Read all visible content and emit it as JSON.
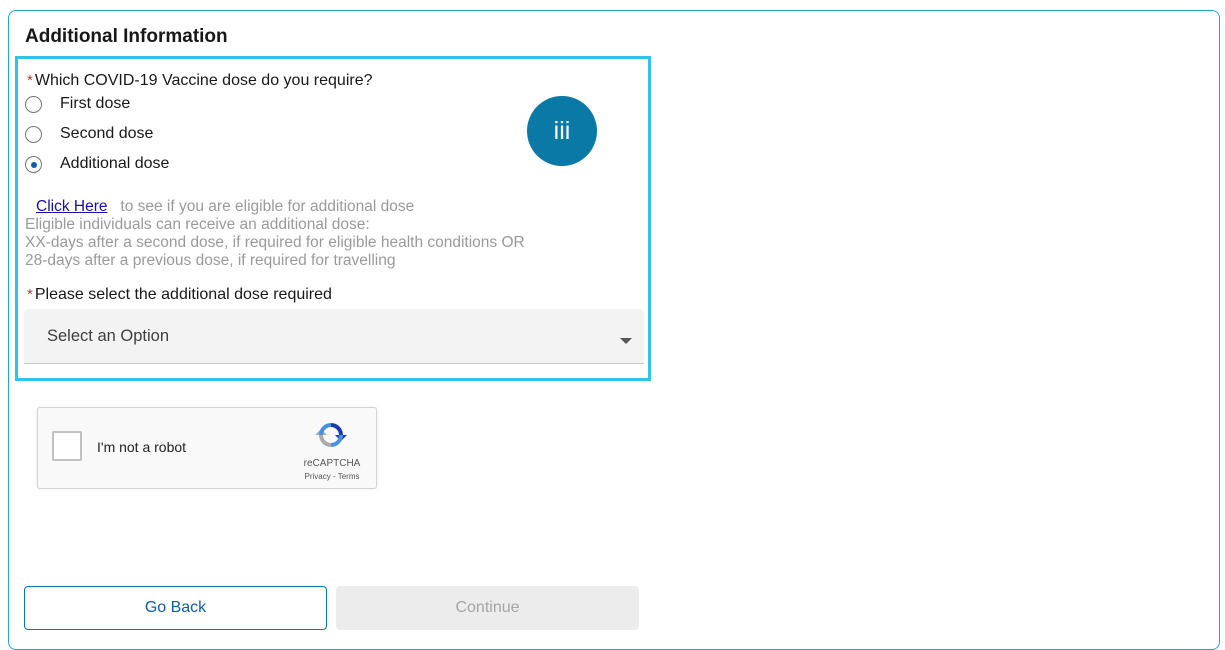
{
  "section": {
    "title": "Additional Information"
  },
  "question": {
    "required_marker": "*",
    "label": "Which COVID-19 Vaccine dose do you require?",
    "options": [
      {
        "label": "First dose",
        "selected": false
      },
      {
        "label": "Second dose",
        "selected": false
      },
      {
        "label": "Additional dose",
        "selected": true
      }
    ]
  },
  "badge": {
    "text": "iii",
    "color": "#0b79a6"
  },
  "info": {
    "link_text": "Click Here",
    "link_suffix": "to see if you are eligible for additional dose",
    "line1": "Eligible individuals can receive an additional dose:",
    "line2": "XX-days after a second dose, if required for eligible health conditions OR",
    "line3": "28-days after a previous dose, if required for travelling"
  },
  "additional_dose": {
    "required_marker": "*",
    "label": "Please select the additional dose required",
    "selected_value": "Select an Option"
  },
  "recaptcha": {
    "label": "I'm not a robot",
    "brand": "reCAPTCHA",
    "terms": "Privacy - Terms"
  },
  "buttons": {
    "back": "Go Back",
    "continue": "Continue"
  },
  "colors": {
    "frame_border": "#1ea8c9",
    "highlight_border": "#2ec3e8",
    "required": "#c23934",
    "primary": "#0b5cab"
  }
}
